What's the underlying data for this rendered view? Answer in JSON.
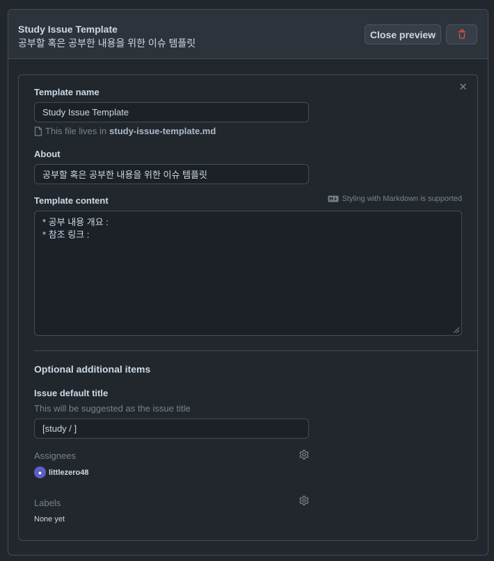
{
  "header": {
    "title": "Study Issue Template",
    "description": "공부할 혹은 공부한 내용을 위한 이슈 템플릿",
    "close_preview_label": "Close preview",
    "delete_icon": "trash-icon"
  },
  "form": {
    "template_name_label": "Template name",
    "template_name_value": "Study Issue Template",
    "file_note_prefix": "This file lives in",
    "file_name": "study-issue-template.md",
    "about_label": "About",
    "about_value": "공부할 혹은 공부한 내용을 위한 이슈 템플릿",
    "content_label": "Template content",
    "markdown_hint": "Styling with Markdown is supported",
    "content_lines": [
      "* 공부 내용 개요 :",
      "* 참조 링크 :"
    ]
  },
  "optional": {
    "section_title": "Optional additional items",
    "issue_title_label": "Issue default title",
    "issue_title_hint": "This will be suggested as the issue title",
    "issue_title_value": "[study / ]",
    "assignees_label": "Assignees",
    "assignee_name": "littlezero48",
    "labels_label": "Labels",
    "labels_value": "None yet"
  },
  "colors": {
    "background": "#22272e",
    "header_bg": "#2d333b",
    "border": "#444c56",
    "delete_red": "#e5534b"
  }
}
